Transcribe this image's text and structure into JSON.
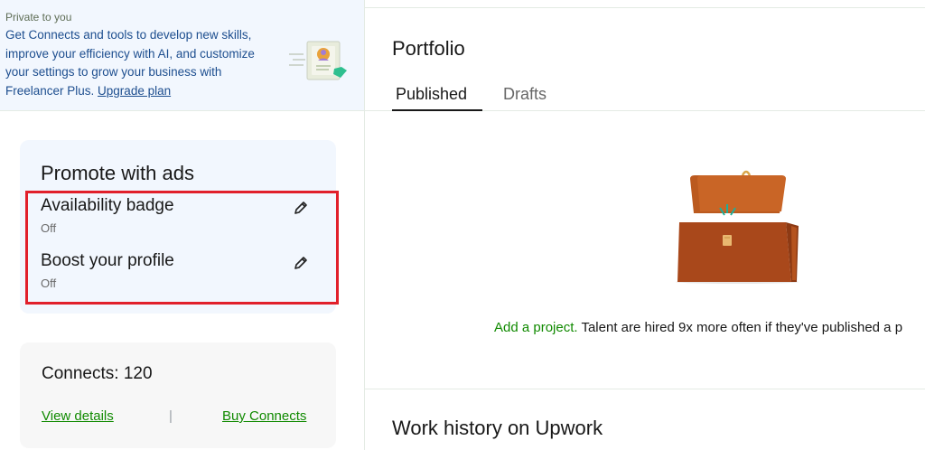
{
  "promo": {
    "eyebrow": "Private to you",
    "body": "Get Connects and tools to develop new skills, improve your efficiency with AI, and customize your settings to grow your business with Freelancer Plus. ",
    "link": "Upgrade plan",
    "illustration_icon": "profile-card-illustration"
  },
  "promote_ads": {
    "title": "Promote with ads",
    "items": [
      {
        "label": "Availability badge",
        "state": "Off",
        "icon": "pencil-icon"
      },
      {
        "label": "Boost your profile",
        "state": "Off",
        "icon": "pencil-icon"
      }
    ],
    "highlight_color": "#e1202b"
  },
  "connects": {
    "label": "Connects: 120",
    "view_details": "View details",
    "separator": "|",
    "buy": "Buy Connects"
  },
  "portfolio": {
    "title": "Portfolio",
    "tabs": [
      {
        "label": "Published",
        "active": true
      },
      {
        "label": "Drafts",
        "active": false
      }
    ],
    "empty_icon": "briefcase-illustration",
    "add_project_link": "Add a project.",
    "add_project_text": " Talent are hired 9x more often if they've published a p"
  },
  "work_history": {
    "title": "Work history on Upwork"
  },
  "colors": {
    "accent_green": "#108a00",
    "link_blue": "#1d4e8f",
    "panel_blue": "#f2f7fe"
  }
}
